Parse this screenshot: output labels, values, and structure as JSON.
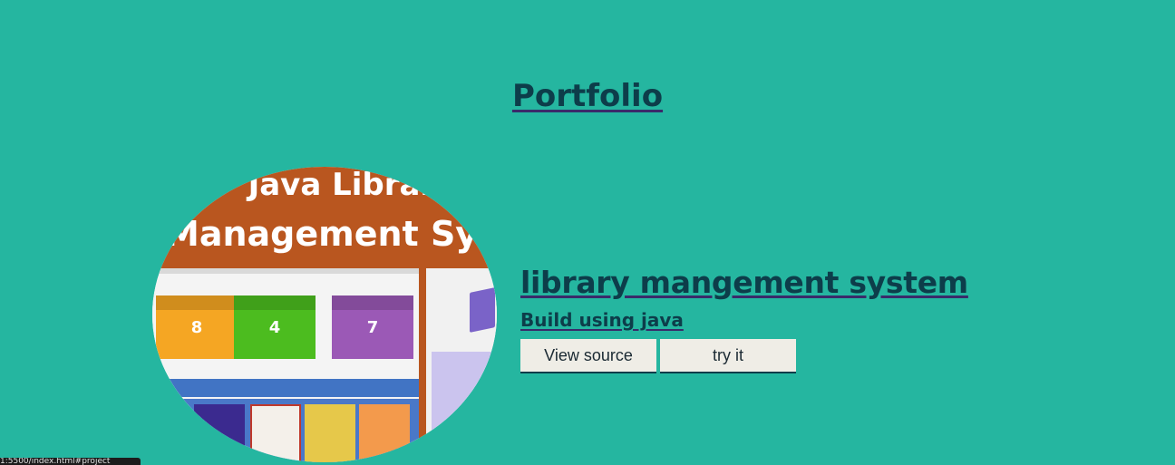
{
  "header": {
    "title": "Portfolio"
  },
  "project": {
    "image_banner_line1": "Java Library",
    "image_banner_line2": "Management System",
    "image_cards": [
      {
        "label": "8",
        "color": "#f5a623"
      },
      {
        "label": "4",
        "color": "#4cbc1f"
      },
      {
        "label": "7",
        "color": "#9b59b6"
      }
    ],
    "title": "library mangement system",
    "subtitle": "Build using java",
    "buttons": {
      "view_source": "View source",
      "try_it": "try it"
    }
  },
  "status_bar": {
    "url": "1:5500/index.html#project"
  },
  "colors": {
    "background": "#25b6a0",
    "heading": "#0d3d4a",
    "button_bg": "#efede6"
  }
}
